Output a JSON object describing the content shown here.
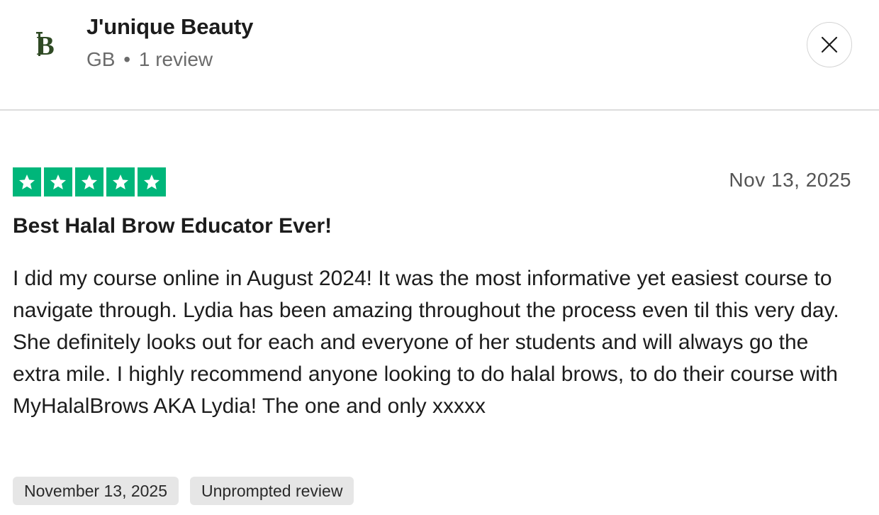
{
  "reviewer": {
    "logo_text": "JB",
    "name": "J'unique Beauty",
    "country": "GB",
    "separator": "•",
    "review_count": "1 review"
  },
  "close_icon": "close-icon",
  "review": {
    "rating": 5,
    "star_color": "#00b67a",
    "date": "Nov 13, 2025",
    "title": "Best Halal Brow Educator Ever!",
    "body": "I did my course online in August 2024! It was the most informative yet easiest course to navigate through. Lydia has been amazing throughout the process even til this very day. She definitely looks out for each and everyone of her students and will always go the extra mile. I highly recommend anyone looking to do halal brows, to do their course with MyHalalBrows AKA Lydia! The one and only xxxxx",
    "tags": [
      "November 13, 2025",
      "Unprompted review"
    ]
  }
}
